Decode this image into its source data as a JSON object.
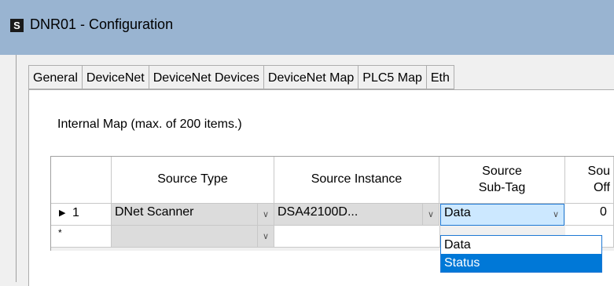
{
  "window": {
    "title": "DNR01 - Configuration",
    "icon_letter": "S"
  },
  "tabs": [
    {
      "label": "General"
    },
    {
      "label": "DeviceNet"
    },
    {
      "label": "DeviceNet Devices"
    },
    {
      "label": "DeviceNet Map"
    },
    {
      "label": "PLC5 Map"
    },
    {
      "label": "Eth"
    }
  ],
  "map": {
    "label": "Internal Map (max. of 200 items.)",
    "columns": {
      "source_type": "Source Type",
      "source_instance": "Source Instance",
      "source_subtag_line1": "Source",
      "source_subtag_line2": "Sub-Tag",
      "source_offset_line1": "Sou",
      "source_offset_line2": "Off"
    },
    "rows": [
      {
        "indicator": "▶",
        "number": "1",
        "source_type": "DNet Scanner",
        "source_instance": "DSA42100D...",
        "source_subtag": "Data",
        "source_offset": "0"
      }
    ],
    "new_row_indicator": "*"
  },
  "dropdown": {
    "options": [
      "Data",
      "Status"
    ],
    "highlighted": "Status"
  }
}
